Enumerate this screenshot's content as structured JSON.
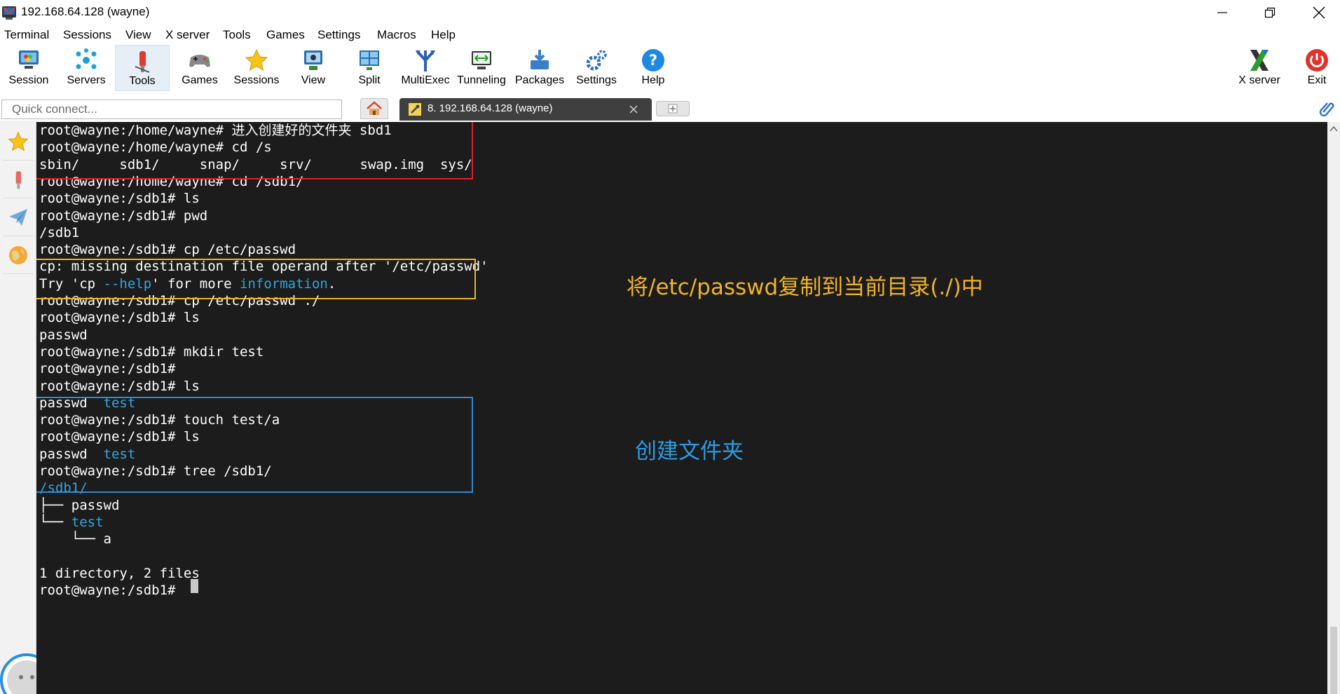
{
  "window": {
    "title": "192.168.64.128 (wayne)"
  },
  "menu": [
    "Terminal",
    "Sessions",
    "View",
    "X server",
    "Tools",
    "Games",
    "Settings",
    "Macros",
    "Help"
  ],
  "toolbar": {
    "left": [
      {
        "label": "Session",
        "icon": "session-icon"
      },
      {
        "label": "Servers",
        "icon": "servers-icon"
      },
      {
        "label": "Tools",
        "icon": "tools-icon",
        "active": true
      },
      {
        "label": "Games",
        "icon": "games-icon"
      },
      {
        "label": "Sessions",
        "icon": "star-icon"
      },
      {
        "label": "View",
        "icon": "view-icon"
      },
      {
        "label": "Split",
        "icon": "split-icon"
      },
      {
        "label": "MultiExec",
        "icon": "multiexec-icon"
      },
      {
        "label": "Tunneling",
        "icon": "tunneling-icon"
      },
      {
        "label": "Packages",
        "icon": "packages-icon"
      },
      {
        "label": "Settings",
        "icon": "settings-icon"
      },
      {
        "label": "Help",
        "icon": "help-icon"
      }
    ],
    "right": [
      {
        "label": "X server",
        "icon": "xserver-icon"
      },
      {
        "label": "Exit",
        "icon": "exit-icon"
      }
    ]
  },
  "quick_connect": {
    "placeholder": "Quick connect..."
  },
  "tabs": {
    "active_label": "8. 192.168.64.128 (wayne)"
  },
  "colors": {
    "terminal_bg": "#1c1c1c",
    "ls_dir_blue": "#2ea8e2",
    "box_red": "#e0201f",
    "box_yellow": "#f0b325",
    "box_blue": "#2b8bd8"
  },
  "terminal": {
    "lines": [
      {
        "segments": [
          {
            "t": "root@wayne:/home/wayne# 进入创建好的文件夹 sbd1"
          }
        ]
      },
      {
        "segments": [
          {
            "t": "root@wayne:/home/wayne# cd /s"
          }
        ]
      },
      {
        "segments": [
          {
            "t": "sbin/     sdb1/     snap/     srv/      swap.img  sys/"
          }
        ]
      },
      {
        "segments": [
          {
            "t": "root@wayne:/home/wayne# cd /sdb1/"
          }
        ]
      },
      {
        "segments": [
          {
            "t": "root@wayne:/sdb1# ls"
          }
        ]
      },
      {
        "segments": [
          {
            "t": "root@wayne:/sdb1# pwd"
          }
        ]
      },
      {
        "segments": [
          {
            "t": "/sdb1"
          }
        ]
      },
      {
        "segments": [
          {
            "t": "root@wayne:/sdb1# cp /etc/passwd"
          }
        ]
      },
      {
        "segments": [
          {
            "t": "cp: missing destination file operand after '/etc/passwd'"
          }
        ]
      },
      {
        "segments": [
          {
            "t": "Try 'cp "
          },
          {
            "t": "--help",
            "c": "blue"
          },
          {
            "t": "' for more "
          },
          {
            "t": "information",
            "c": "blue"
          },
          {
            "t": "."
          }
        ]
      },
      {
        "segments": [
          {
            "t": "root@wayne:/sdb1# cp /etc/passwd ./"
          }
        ]
      },
      {
        "segments": [
          {
            "t": "root@wayne:/sdb1# ls"
          }
        ]
      },
      {
        "segments": [
          {
            "t": "passwd"
          }
        ]
      },
      {
        "segments": [
          {
            "t": "root@wayne:/sdb1# mkdir test"
          }
        ]
      },
      {
        "segments": [
          {
            "t": "root@wayne:/sdb1#"
          }
        ]
      },
      {
        "segments": [
          {
            "t": "root@wayne:/sdb1# ls"
          }
        ]
      },
      {
        "segments": [
          {
            "t": "passwd  "
          },
          {
            "t": "test",
            "c": "blue"
          }
        ]
      },
      {
        "segments": [
          {
            "t": "root@wayne:/sdb1# touch test/a"
          }
        ]
      },
      {
        "segments": [
          {
            "t": "root@wayne:/sdb1# ls"
          }
        ]
      },
      {
        "segments": [
          {
            "t": "passwd  "
          },
          {
            "t": "test",
            "c": "blue"
          }
        ]
      },
      {
        "segments": [
          {
            "t": "root@wayne:/sdb1# tree /sdb1/"
          }
        ]
      },
      {
        "segments": [
          {
            "t": "/sdb1/",
            "c": "blue"
          }
        ]
      },
      {
        "segments": [
          {
            "t": "├── passwd"
          }
        ]
      },
      {
        "segments": [
          {
            "t": "└── "
          },
          {
            "t": "test",
            "c": "blue"
          }
        ]
      },
      {
        "segments": [
          {
            "t": "    └── a"
          }
        ]
      },
      {
        "segments": [
          {
            "t": ""
          }
        ]
      },
      {
        "segments": [
          {
            "t": "1 directory, 2 files"
          }
        ]
      },
      {
        "segments": [
          {
            "t": "root@wayne:/sdb1# "
          }
        ]
      }
    ]
  },
  "annotations": {
    "copy_note": "将/etc/passwd复制到当前目录(./)中",
    "folder_note": "创建文件夹"
  }
}
